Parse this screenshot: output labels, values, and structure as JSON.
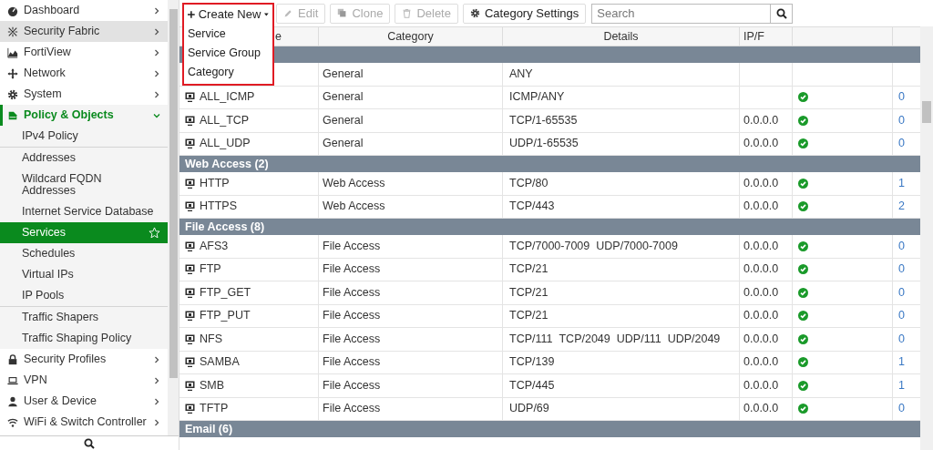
{
  "sidebar": {
    "items": [
      {
        "label": "Dashboard",
        "highlighted": false,
        "expanded": false
      },
      {
        "label": "Security Fabric",
        "highlighted": true,
        "expanded": false
      },
      {
        "label": "FortiView",
        "highlighted": false,
        "expanded": false
      },
      {
        "label": "Network",
        "highlighted": false,
        "expanded": false
      },
      {
        "label": "System",
        "highlighted": false,
        "expanded": false
      },
      {
        "label": "Policy & Objects",
        "highlighted": false,
        "expanded": true,
        "children": [
          {
            "label": "IPv4 Policy",
            "selected": false,
            "divider_before": false
          },
          {
            "label": "Addresses",
            "selected": false,
            "divider_before": true
          },
          {
            "label": "Wildcard FQDN\nAddresses",
            "selected": false,
            "divider_before": false
          },
          {
            "label": "Internet Service Database",
            "selected": false,
            "divider_before": false
          },
          {
            "label": "Services",
            "selected": true,
            "divider_before": false
          },
          {
            "label": "Schedules",
            "selected": false,
            "divider_before": false
          },
          {
            "label": "Virtual IPs",
            "selected": false,
            "divider_before": false
          },
          {
            "label": "IP Pools",
            "selected": false,
            "divider_before": false
          },
          {
            "label": "Traffic Shapers",
            "selected": false,
            "divider_before": true
          },
          {
            "label": "Traffic Shaping Policy",
            "selected": false,
            "divider_before": false
          }
        ]
      },
      {
        "label": "Security Profiles",
        "highlighted": false,
        "expanded": false
      },
      {
        "label": "VPN",
        "highlighted": false,
        "expanded": false
      },
      {
        "label": "User & Device",
        "highlighted": false,
        "expanded": false
      },
      {
        "label": "WiFi & Switch Controller",
        "highlighted": false,
        "expanded": false
      }
    ]
  },
  "toolbar": {
    "create_new": {
      "label": "Create New",
      "open": true,
      "menu": [
        "Service",
        "Service Group",
        "Category"
      ]
    },
    "buttons": [
      {
        "label": "Edit",
        "disabled": true
      },
      {
        "label": "Clone",
        "disabled": true
      },
      {
        "label": "Delete",
        "disabled": true
      },
      {
        "label": "Category Settings",
        "disabled": false
      }
    ],
    "search": {
      "placeholder": "Search"
    }
  },
  "table": {
    "columns": [
      "e",
      "Category",
      "Details",
      "IP/F"
    ],
    "groups": [
      {
        "rows": [
          {
            "category": "General",
            "details": [
              "ANY"
            ]
          },
          {
            "name": "ALL_ICMP",
            "category": "General",
            "details": [
              "ICMP/ANY"
            ],
            "shown": true,
            "ref": "0"
          },
          {
            "name": "ALL_TCP",
            "category": "General",
            "details": [
              "TCP/1-65535"
            ],
            "ip": "0.0.0.0",
            "shown": true,
            "ref": "0"
          },
          {
            "name": "ALL_UDP",
            "category": "General",
            "details": [
              "UDP/1-65535"
            ],
            "ip": "0.0.0.0",
            "shown": true,
            "ref": "0"
          }
        ]
      },
      {
        "label": "Web Access (2)",
        "rows": [
          {
            "name": "HTTP",
            "category": "Web Access",
            "details": [
              "TCP/80"
            ],
            "ip": "0.0.0.0",
            "shown": true,
            "ref": "1"
          },
          {
            "name": "HTTPS",
            "category": "Web Access",
            "details": [
              "TCP/443"
            ],
            "ip": "0.0.0.0",
            "shown": true,
            "ref": "2"
          }
        ]
      },
      {
        "label": "File Access (8)",
        "rows": [
          {
            "name": "AFS3",
            "category": "File Access",
            "details": [
              "TCP/7000-7009",
              "UDP/7000-7009"
            ],
            "ip": "0.0.0.0",
            "shown": true,
            "ref": "0"
          },
          {
            "name": "FTP",
            "category": "File Access",
            "details": [
              "TCP/21"
            ],
            "ip": "0.0.0.0",
            "shown": true,
            "ref": "0"
          },
          {
            "name": "FTP_GET",
            "category": "File Access",
            "details": [
              "TCP/21"
            ],
            "ip": "0.0.0.0",
            "shown": true,
            "ref": "0"
          },
          {
            "name": "FTP_PUT",
            "category": "File Access",
            "details": [
              "TCP/21"
            ],
            "ip": "0.0.0.0",
            "shown": true,
            "ref": "0"
          },
          {
            "name": "NFS",
            "category": "File Access",
            "details": [
              "TCP/111",
              "TCP/2049",
              "UDP/111",
              "UDP/2049"
            ],
            "ip": "0.0.0.0",
            "shown": true,
            "ref": "0"
          },
          {
            "name": "SAMBA",
            "category": "File Access",
            "details": [
              "TCP/139"
            ],
            "ip": "0.0.0.0",
            "shown": true,
            "ref": "1"
          },
          {
            "name": "SMB",
            "category": "File Access",
            "details": [
              "TCP/445"
            ],
            "ip": "0.0.0.0",
            "shown": true,
            "ref": "1"
          },
          {
            "name": "TFTP",
            "category": "File Access",
            "details": [
              "UDP/69"
            ],
            "ip": "0.0.0.0",
            "shown": true,
            "ref": "0"
          }
        ]
      },
      {
        "label": "Email (6)"
      }
    ]
  }
}
